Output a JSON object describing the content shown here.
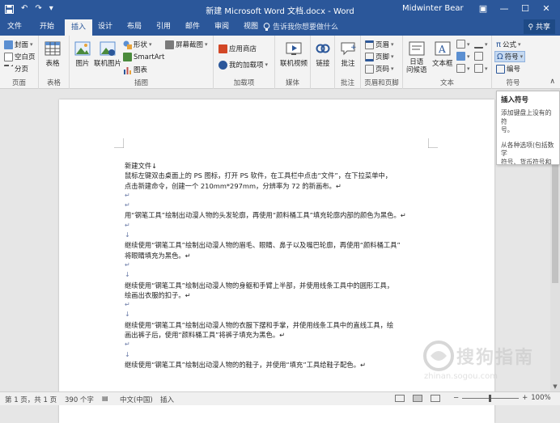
{
  "titlebar": {
    "undo_icon": "↶",
    "redo_icon": "↷",
    "save_icon": "save-icon",
    "customize_icon": "▾",
    "title": "新建 Microsoft Word 文档.docx  -  Word",
    "user": "Midwinter Bear",
    "ribbon_display": "▣",
    "minimize": "—",
    "maximize": "☐",
    "close": "✕"
  },
  "tabs": {
    "file": "文件",
    "home": "开始",
    "insert": "插入",
    "design": "设计",
    "layout": "布局",
    "references": "引用",
    "mailings": "邮件",
    "review": "审阅",
    "view": "视图",
    "tellme": "告诉我你想要做什么",
    "share": "共享"
  },
  "ribbon": {
    "pages": {
      "cover": "封面",
      "blank": "空白页",
      "break": "分页",
      "label": "页面"
    },
    "tables": {
      "table": "表格",
      "label": "表格"
    },
    "illustrations": {
      "picture": "图片",
      "online_picture": "联机图片",
      "shapes": "形状",
      "smartart": "SmartArt",
      "chart": "图表",
      "screenshot": "屏幕截图",
      "label": "插图"
    },
    "addins": {
      "store": "应用商店",
      "myaddins": "我的加载项",
      "label": "加载项"
    },
    "media": {
      "online_video": "联机视频",
      "label": "媒体"
    },
    "links": {
      "link": "链接",
      "label": ""
    },
    "comments": {
      "comment": "批注",
      "label": "批注"
    },
    "header_footer": {
      "header": "页眉",
      "footer": "页脚",
      "page_number": "页码",
      "label": "页眉和页脚"
    },
    "text": {
      "textbox": "文本框",
      "wordart": "日语\n问候语",
      "label": "文本"
    },
    "symbols": {
      "equation": "公式",
      "symbol": "符号",
      "number": "编号",
      "label": "符号"
    }
  },
  "tooltip": {
    "title": "插入符号",
    "p1": "添加键盘上没有的符\n号。",
    "p2": "从各种选项(包括数学\n符号、货币符号和版\n权符号)中进行选择。"
  },
  "document": {
    "lines": [
      "新建文件↓",
      "鼠标左键双击桌面上的 PS 图标，打开 PS 软件，在工具栏中点击“文件”，在下拉菜单中，",
      "点击新建命令，创建一个 210mm*297mm，分辨率为 72 的新画布。↵",
      "↵",
      "↵",
      "用“钢笔工具”绘制出动漫人物的头发轮廓，再使用“颜料桶工具”填充轮廓内部的颜色为黑色。↵",
      "↵",
      "↓",
      "继续使用“钢笔工具”绘制出动漫人物的眉毛、眼睛、鼻子以及嘴巴轮廓，再使用“颜料桶工具”",
      "将眼睛填充为黑色。↵",
      "↵",
      "↓",
      "继续使用“钢笔工具”绘制出动漫人物的身躯和手臂上半部，并使用线条工具中的圆形工具，",
      "绘画出衣服的扣子。↵",
      "↵",
      "↓",
      "继续使用“钢笔工具”绘制出动漫人物的衣服下摆和手掌，并使用线条工具中的直线工具，绘",
      "画出裤子后，使用“颜料桶工具”将裤子填充为黑色。↵",
      "↵",
      "↓",
      "继续使用“钢笔工具”绘制出动漫人物的的鞋子，并使用“填充”工具给鞋子配色。↵"
    ]
  },
  "statusbar": {
    "page": "第 1 页，共 1 页",
    "words": "390 个字",
    "language": "中文(中国)",
    "mode": "插入",
    "zoom_minus": "−",
    "zoom_plus": "+",
    "zoom_level": "100%"
  },
  "watermark": {
    "text": "搜狗指南",
    "url": "zhinan.sogou.com"
  },
  "colors": {
    "accent": "#2b579a",
    "ribbon_bg": "#f3f3f3",
    "page_bg": "#ffffff"
  }
}
